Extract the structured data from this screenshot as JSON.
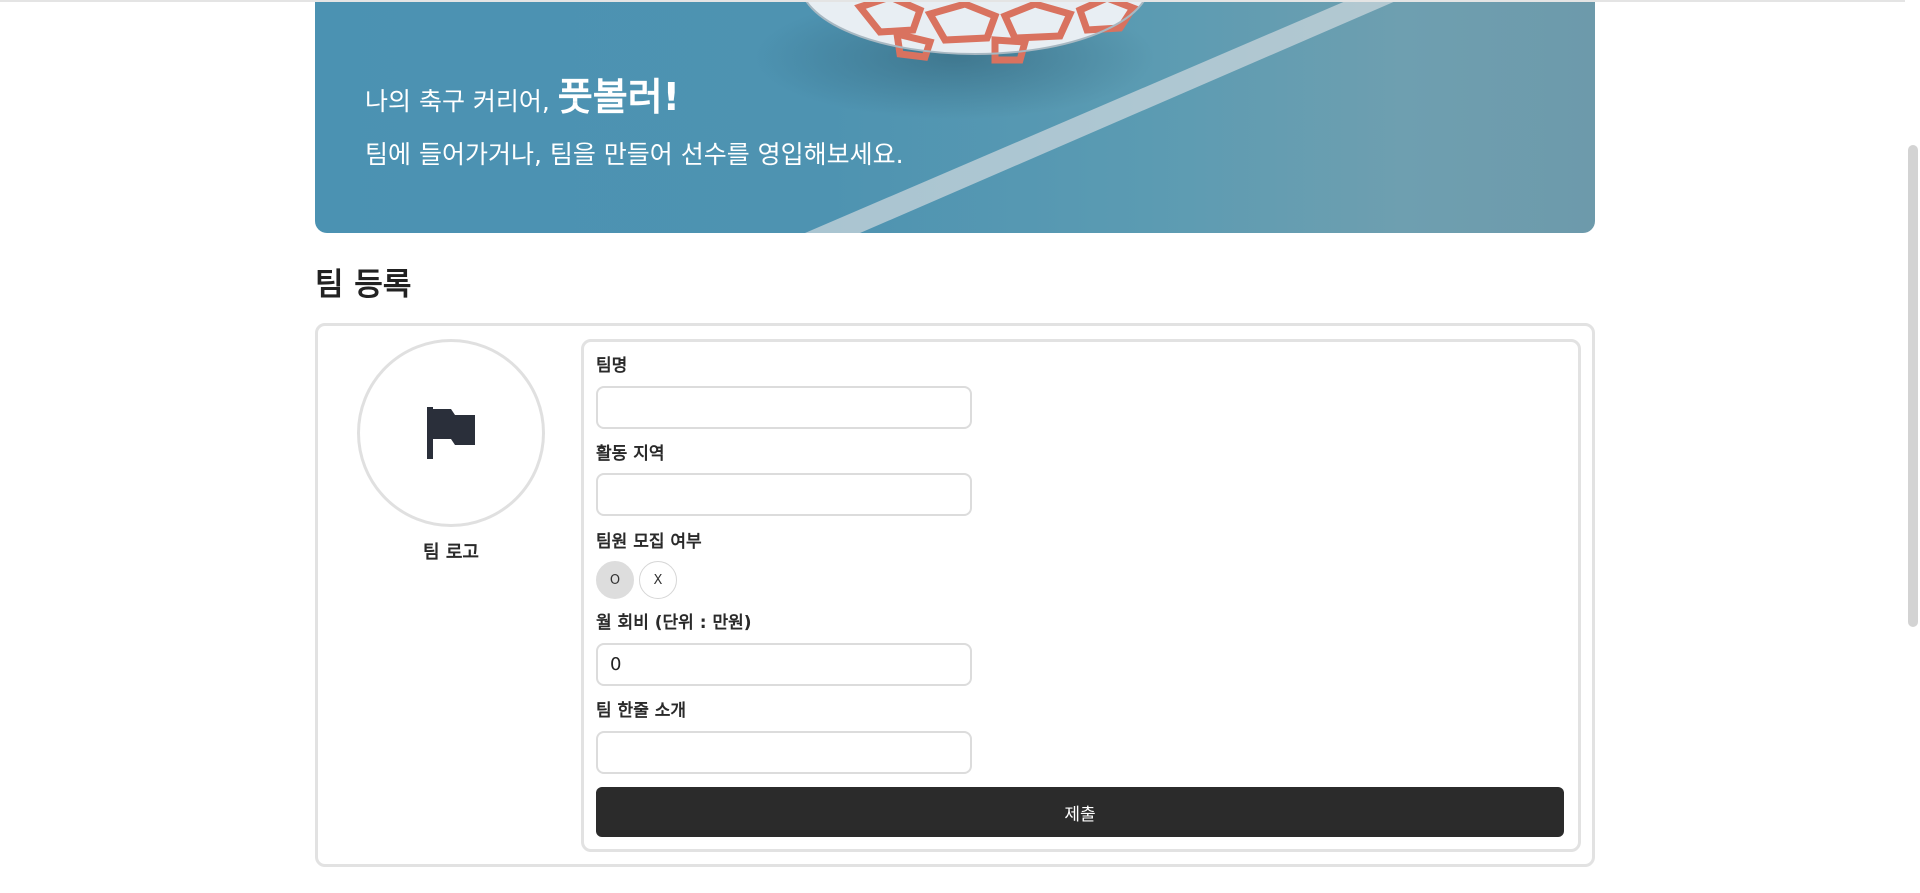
{
  "banner": {
    "line1_prefix": "나의 축구 커리어,",
    "brand": "풋볼러!",
    "line2": "팀에 들어가거나, 팀을 만들어 선수를 영입해보세요."
  },
  "page_title": "팀 등록",
  "logo": {
    "label": "팀 로고",
    "icon": "flag-icon"
  },
  "form": {
    "team_name": {
      "label": "팀명",
      "value": ""
    },
    "region": {
      "label": "활동 지역",
      "value": ""
    },
    "recruit": {
      "label": "팀원 모집 여부",
      "options": [
        "O",
        "X"
      ],
      "selected": "O"
    },
    "monthly_fee": {
      "label": "월 회비 (단위 : 만원)",
      "value": "0"
    },
    "intro": {
      "label": "팀 한줄 소개",
      "value": ""
    },
    "submit_label": "제출"
  },
  "colors": {
    "banner": "#4e93b1",
    "button": "#2b2b2b",
    "border": "#e2e2e2",
    "selected_toggle": "#dddddd"
  }
}
